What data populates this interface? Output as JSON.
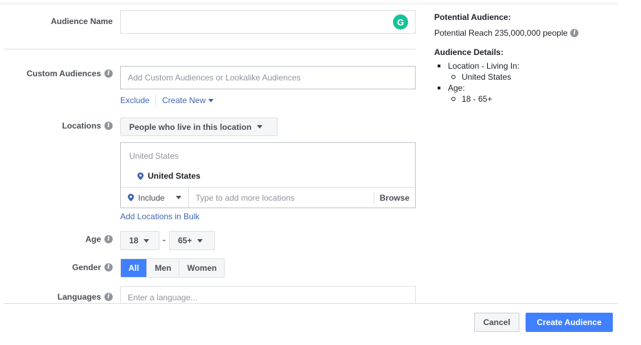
{
  "form": {
    "audience_name": {
      "label": "Audience Name",
      "value": "",
      "grammarly_glyph": "G"
    },
    "custom_audiences": {
      "label": "Custom Audiences",
      "placeholder": "Add Custom Audiences or Lookalike Audiences",
      "exclude_label": "Exclude",
      "create_new_label": "Create New"
    },
    "locations": {
      "label": "Locations",
      "dropdown_label": "People who live in this location",
      "country_header": "United States",
      "selected": "United States",
      "include_label": "Include",
      "type_placeholder": "Type to add more locations",
      "browse_label": "Browse",
      "bulk_label": "Add Locations in Bulk"
    },
    "age": {
      "label": "Age",
      "min": "18",
      "separator": "-",
      "max": "65+"
    },
    "gender": {
      "label": "Gender",
      "options": [
        "All",
        "Men",
        "Women"
      ],
      "selected": "All"
    },
    "languages": {
      "label": "Languages",
      "placeholder": "Enter a language..."
    }
  },
  "summary": {
    "potential_heading": "Potential Audience:",
    "potential_reach": "Potential Reach 235,000,000 people",
    "details_heading": "Audience Details:",
    "location_item": "Location - Living In:",
    "location_value": "United States",
    "age_item": "Age:",
    "age_value": "18 - 65+"
  },
  "footer": {
    "cancel_label": "Cancel",
    "create_label": "Create Audience"
  },
  "colors": {
    "accent": "#4080ff",
    "link": "#4267b2",
    "grammarly": "#15c39a",
    "pin": "#4267b2"
  },
  "icons": {
    "info": "info-icon",
    "pin": "location-pin-icon",
    "caret": "caret-down-icon",
    "grammarly": "grammarly-icon"
  }
}
